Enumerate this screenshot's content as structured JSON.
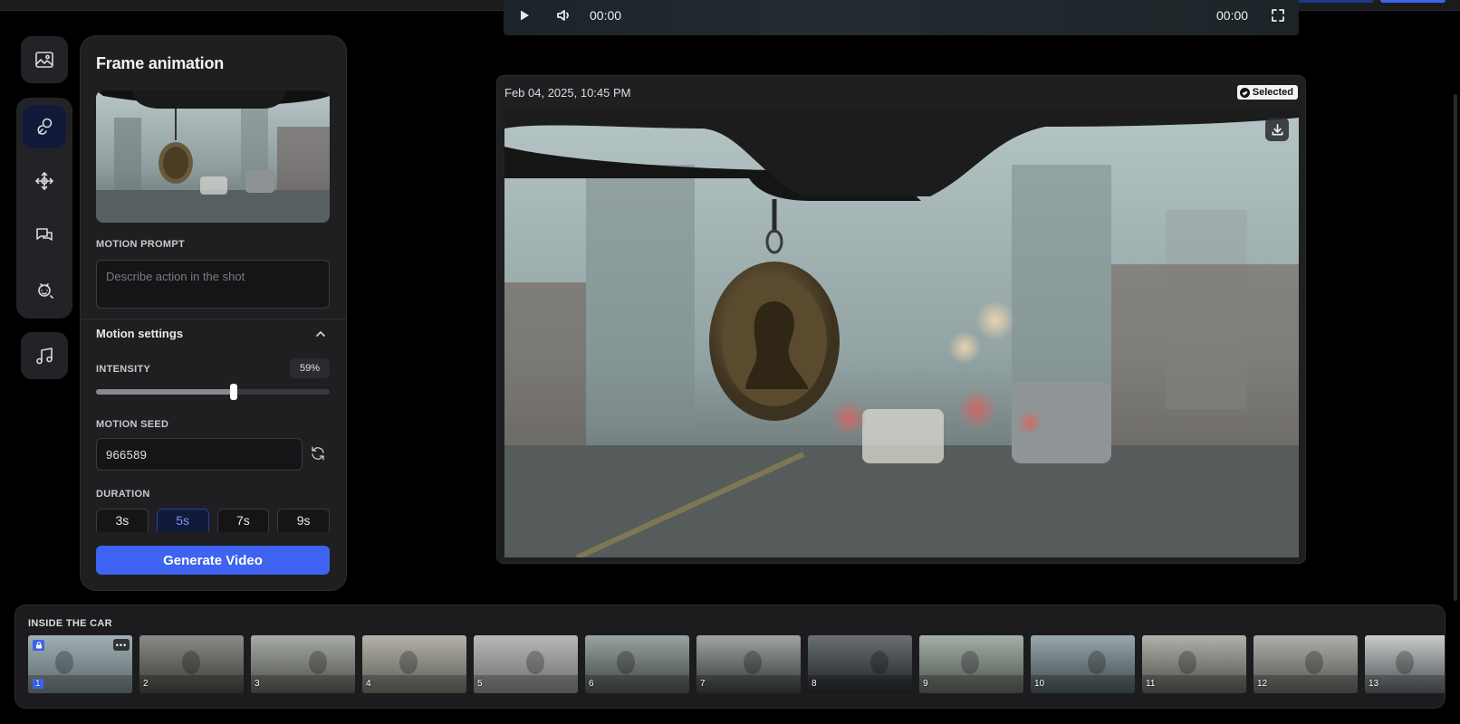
{
  "player": {
    "current_time": "00:00",
    "total_time": "00:00"
  },
  "panel": {
    "title": "Frame animation",
    "motion_prompt_label": "MOTION PROMPT",
    "motion_prompt_placeholder": "Describe action in the shot",
    "settings_title": "Motion settings",
    "intensity_label": "INTENSITY",
    "intensity_value": "59%",
    "intensity_fraction": 0.59,
    "seed_label": "MOTION SEED",
    "seed_value": "966589",
    "duration_label": "DURATION",
    "durations": [
      "3s",
      "5s",
      "7s",
      "9s"
    ],
    "selected_duration": "5s",
    "generate_label": "Generate Video"
  },
  "card": {
    "timestamp": "Feb 04, 2025, 10:45 PM",
    "selected_label": "Selected"
  },
  "strip": {
    "title": "INSIDE THE CAR",
    "frames": [
      "1",
      "2",
      "3",
      "4",
      "5",
      "6",
      "7",
      "8",
      "9",
      "10",
      "11",
      "12",
      "13"
    ],
    "selected_frame": "1"
  },
  "icons": {
    "rail": [
      "image-icon",
      "link-icon",
      "move-icon",
      "chat-icon",
      "face-scan-icon",
      "music-icon"
    ],
    "accent": "#3d63f0"
  }
}
